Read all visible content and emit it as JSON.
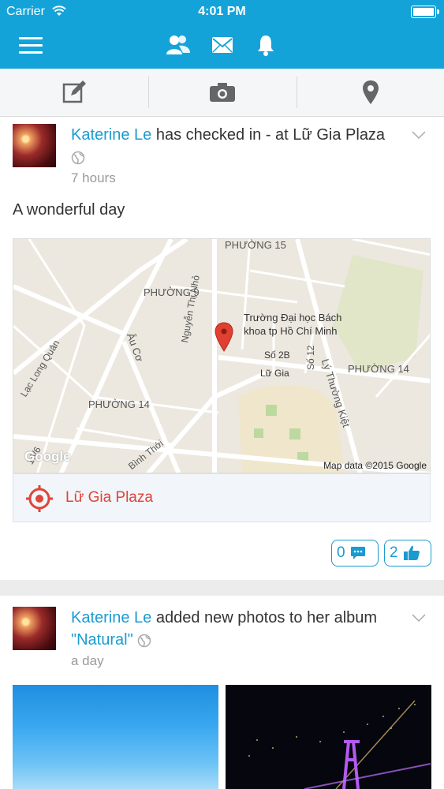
{
  "status": {
    "carrier": "Carrier",
    "time": "4:01 PM"
  },
  "nav": {
    "icons": [
      "menu-icon",
      "friends-icon",
      "messages-icon",
      "notifications-icon"
    ]
  },
  "actions": [
    "compose-icon",
    "camera-icon",
    "location-pin-icon"
  ],
  "posts": [
    {
      "author": "Katerine Le",
      "action_text": " has checked in - at ",
      "place": "Lữ Gia Plaza",
      "time": "7 hours",
      "text": "A wonderful day",
      "map": {
        "labels": [
          "PHƯỜNG 15",
          "PHƯỜNG 9",
          "Trường Đại học Bách",
          "khoa tp Hồ Chí Minh",
          "Nguyễn Thị Nhỏ",
          "Số 2B",
          "Số 12",
          "Lữ Gia",
          "PHƯỜNG 14",
          "Lý Thường Kiệt",
          "Âu Cơ",
          "Lạc Long Quân",
          "PHƯỜNG 14",
          "Bình Thới",
          "16/6",
          "Google"
        ],
        "attribution": "Map data ©2015 Google"
      },
      "place_label": "Lữ Gia Plaza",
      "comments": "0",
      "likes": "2"
    },
    {
      "author": "Katerine Le",
      "action_text": " added new photos to her album",
      "album": "\"Natural\"",
      "time": "a day"
    }
  ],
  "colors": {
    "brand": "#14a3d9",
    "link": "#1a9bd0",
    "place": "#e0443a"
  }
}
